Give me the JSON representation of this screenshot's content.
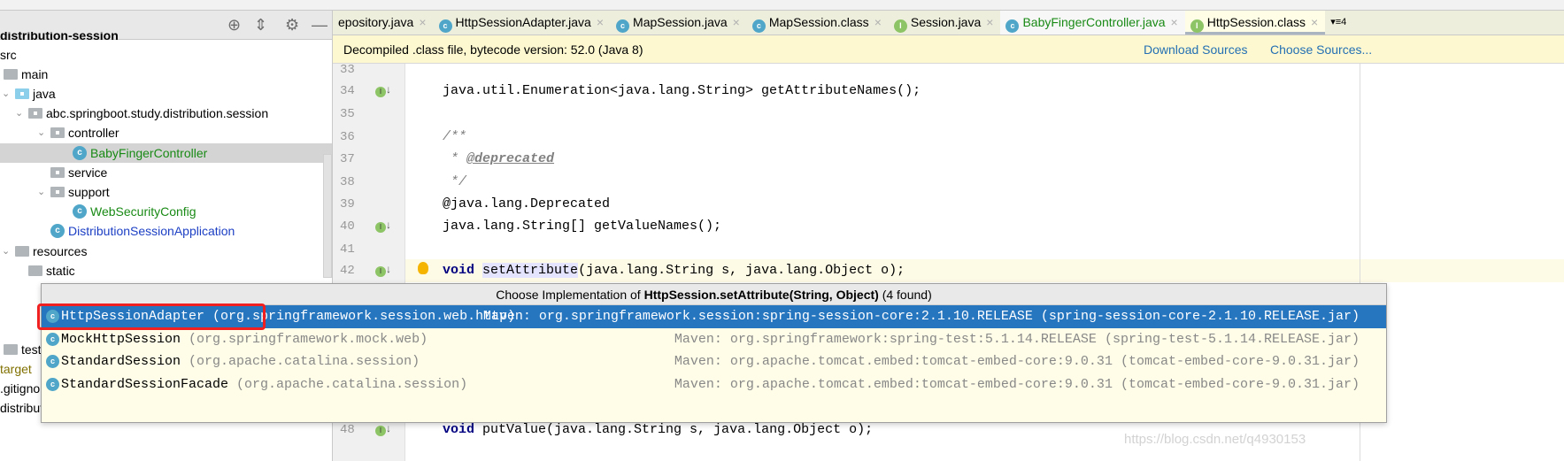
{
  "project_panel": {
    "title": "distribution-session",
    "tree": [
      {
        "label": "src",
        "icon": "none"
      },
      {
        "label": "main",
        "icon": "folder-icon"
      },
      {
        "label": "java",
        "icon": "source-folder-icon"
      },
      {
        "label": "abc.springboot.study.distribution.session",
        "icon": "package-icon"
      },
      {
        "label": "controller",
        "icon": "package-icon"
      },
      {
        "label": "BabyFingerController",
        "icon": "class-icon",
        "selected": true
      },
      {
        "label": "service",
        "icon": "package-icon"
      },
      {
        "label": "support",
        "icon": "package-icon"
      },
      {
        "label": "WebSecurityConfig",
        "icon": "class-icon"
      },
      {
        "label": "DistributionSessionApplication",
        "icon": "spring-boot-app-icon"
      },
      {
        "label": "resources",
        "icon": "resources-folder-icon"
      },
      {
        "label": "static",
        "icon": "folder-icon"
      },
      {
        "label": "test",
        "icon": "folder-icon"
      },
      {
        "label": "target",
        "icon": "none"
      },
      {
        "label": ".gitignore",
        "icon": "none"
      },
      {
        "label": "distribution-session.iml",
        "icon": "none"
      }
    ]
  },
  "tabs": [
    {
      "label": "epository.java",
      "icon": "none"
    },
    {
      "label": "HttpSessionAdapter.java",
      "icon": "class-icon"
    },
    {
      "label": "MapSession.java",
      "icon": "class-icon"
    },
    {
      "label": "MapSession.class",
      "icon": "class-icon"
    },
    {
      "label": "Session.java",
      "icon": "interface-icon"
    },
    {
      "label": "BabyFingerController.java",
      "icon": "class-icon"
    },
    {
      "label": "HttpSession.class",
      "icon": "interface-icon",
      "active": true
    }
  ],
  "tab_overflow": "▾≡4",
  "banner": {
    "text": "Decompiled .class file, bytecode version: 52.0 (Java 8)",
    "download_sources": "Download Sources",
    "choose_sources": "Choose Sources..."
  },
  "code_lines": [
    {
      "n": "33",
      "text": ""
    },
    {
      "n": "34",
      "text": "    java.util.Enumeration<java.lang.String> getAttributeNames();"
    },
    {
      "n": "35",
      "text": ""
    },
    {
      "n": "36",
      "text": "    /**"
    },
    {
      "n": "37",
      "text": "     * @deprecated"
    },
    {
      "n": "38",
      "text": "     */"
    },
    {
      "n": "39",
      "text": "    @java.lang.Deprecated"
    },
    {
      "n": "40",
      "text": "    java.lang.String[] getValueNames();"
    },
    {
      "n": "41",
      "text": ""
    },
    {
      "n": "42",
      "text": "    void setAttribute(java.lang.String s, java.lang.Object o);"
    },
    {
      "n": "48",
      "text": "    void putValue(java.lang.String s, java.lang.Object o);"
    }
  ],
  "popup": {
    "title_prefix": "Choose Implementation of ",
    "title_bold": "HttpSession.setAttribute(String, Object)",
    "title_suffix": " (4 found)",
    "items": [
      {
        "name": "HttpSessionAdapter",
        "package": "(org.springframework.session.web.http)",
        "location": "Maven: org.springframework.session:spring-session-core:2.1.10.RELEASE (spring-session-core-2.1.10.RELEASE.jar)",
        "selected": true
      },
      {
        "name": "MockHttpSession",
        "package": "(org.springframework.mock.web)",
        "location": "Maven: org.springframework:spring-test:5.1.14.RELEASE (spring-test-5.1.14.RELEASE.jar)"
      },
      {
        "name": "StandardSession",
        "package": "(org.apache.catalina.session)",
        "location": "Maven: org.apache.tomcat.embed:tomcat-embed-core:9.0.31 (tomcat-embed-core-9.0.31.jar)"
      },
      {
        "name": "StandardSessionFacade",
        "package": "(org.apache.catalina.session)",
        "location": "Maven: org.apache.tomcat.embed:tomcat-embed-core:9.0.31 (tomcat-embed-core-9.0.31.jar)"
      }
    ]
  },
  "watermark": "https://blog.csdn.net/q4930153",
  "colors": {
    "selection": "#2675bf",
    "highlight_box": "#f02020",
    "banner_bg": "#fdf8d0",
    "link": "#2470b3"
  }
}
